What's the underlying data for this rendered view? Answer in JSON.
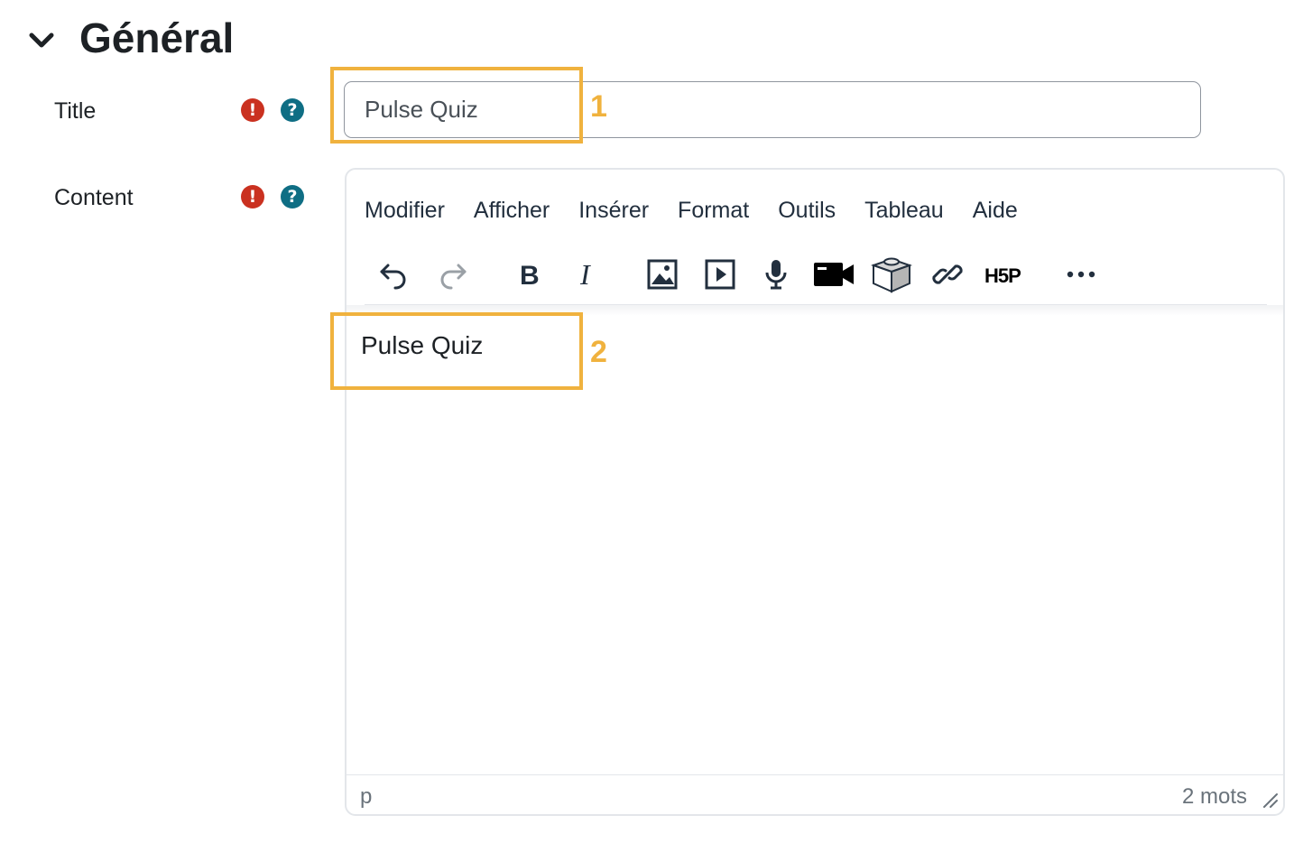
{
  "section": {
    "title": "Général",
    "chevron_icon": "chevron-down-icon"
  },
  "fields": {
    "title": {
      "label": "Title",
      "value": "Pulse Quiz",
      "required_icon": "exclamation-circle-icon",
      "help_icon": "question-circle-icon"
    },
    "content": {
      "label": "Content",
      "required_icon": "exclamation-circle-icon",
      "help_icon": "question-circle-icon"
    }
  },
  "editor": {
    "menus": [
      "Modifier",
      "Afficher",
      "Insérer",
      "Format",
      "Outils",
      "Tableau",
      "Aide"
    ],
    "toolbar": [
      "undo-icon",
      "redo-icon",
      "bold-icon",
      "italic-icon",
      "image-icon",
      "media-icon",
      "microphone-icon",
      "video-camera-icon",
      "cube-icon",
      "link-icon",
      "h5p-icon",
      "more-icon"
    ],
    "content": "Pulse Quiz",
    "status_path": "p",
    "word_count": "2 mots"
  },
  "annotations": {
    "box1_label": "1",
    "box2_label": "2"
  },
  "colors": {
    "annotation": "#f0b23e",
    "required": "#ca3120",
    "help": "#0f6e84"
  }
}
